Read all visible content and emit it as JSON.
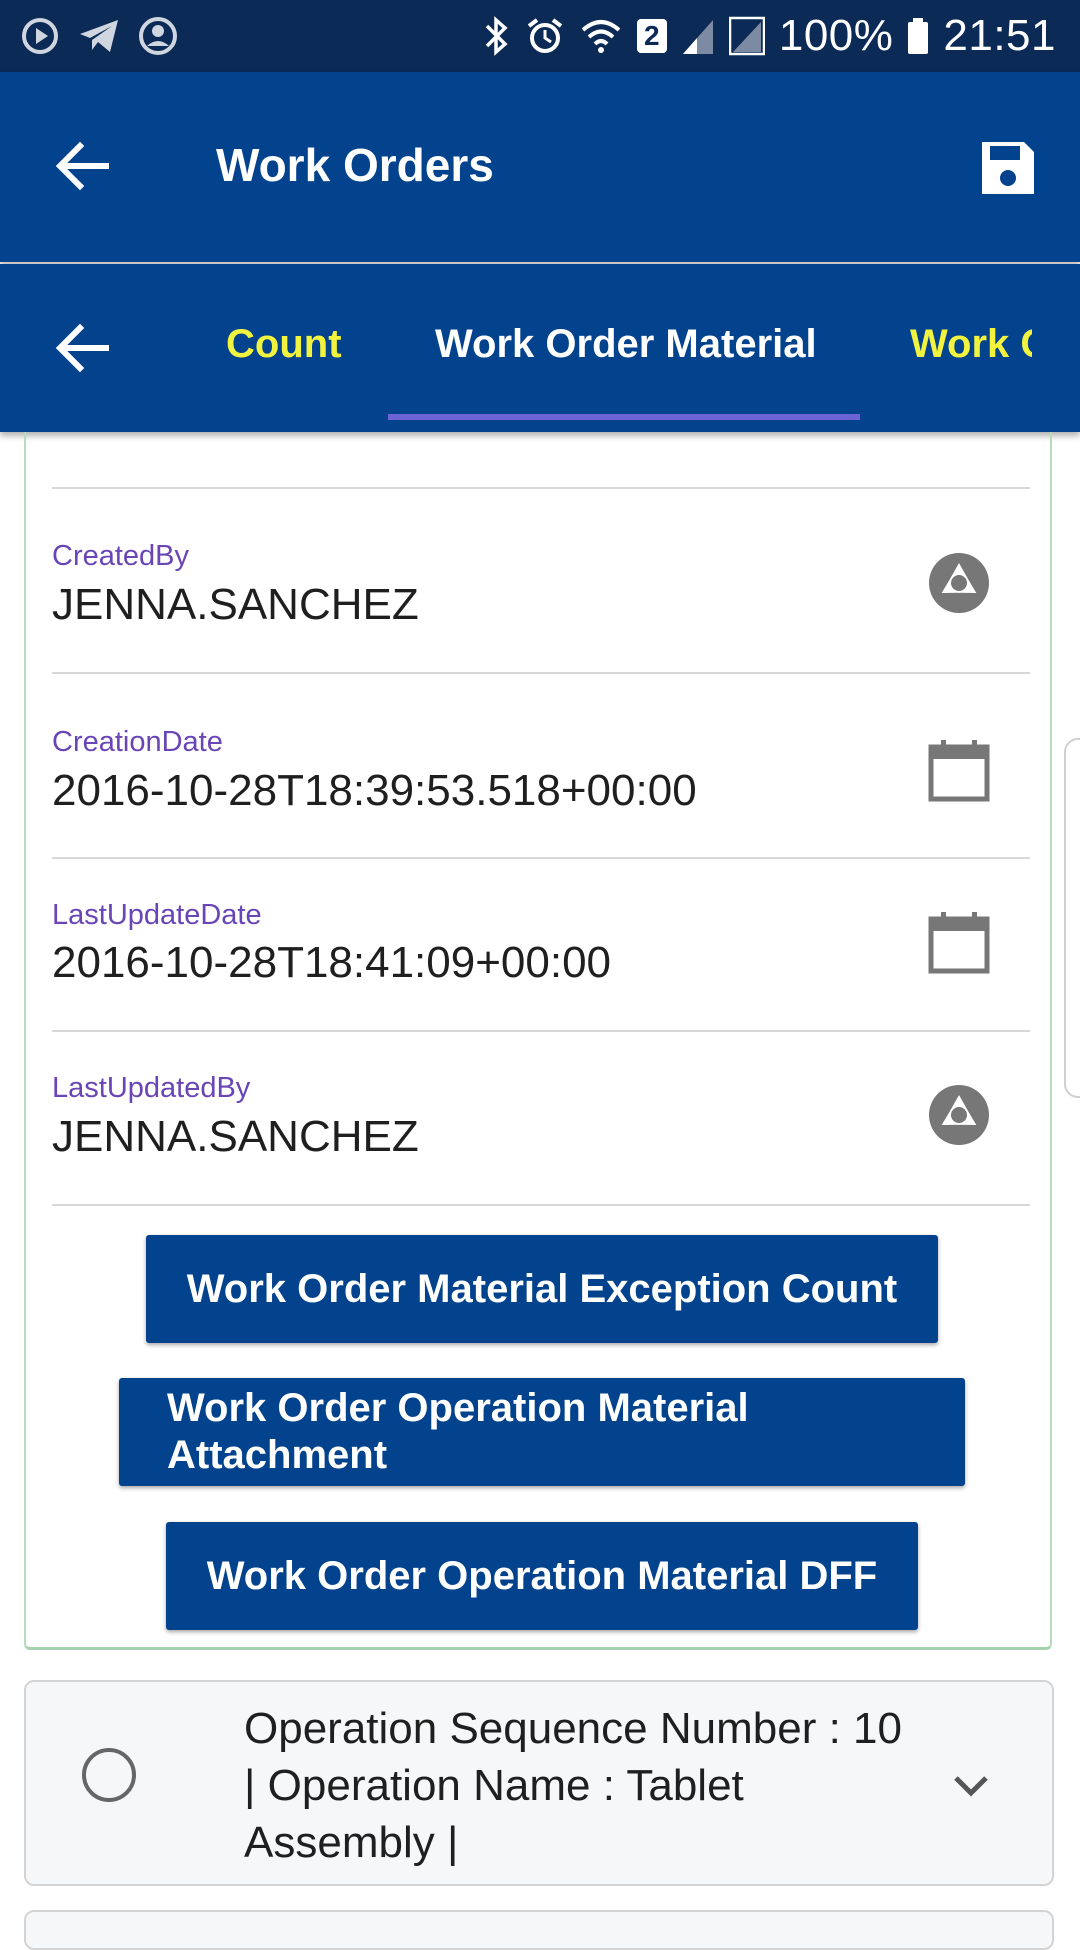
{
  "status_bar": {
    "battery": "100%",
    "time": "21:51",
    "sim_badge": "2",
    "icons": [
      "play-circle-icon",
      "telegram-icon",
      "account-circle-icon",
      "bluetooth-icon",
      "alarm-icon",
      "wifi-icon",
      "signal-icon",
      "signal-r-icon",
      "battery-icon"
    ]
  },
  "app_bar": {
    "title": "Work Orders",
    "back_icon": "back-arrow-icon",
    "save_icon": "save-icon"
  },
  "tabs": {
    "back_icon": "back-arrow-icon",
    "items": [
      {
        "label": "Count",
        "active": false
      },
      {
        "label": "Work Order Material",
        "active": true
      },
      {
        "label": "Work C",
        "active": false
      }
    ],
    "active_underline_color": "#6b63d6",
    "inactive_color": "#f2f33f"
  },
  "fields": [
    {
      "label": "CreatedBy",
      "value": "JENNA.SANCHEZ",
      "icon": "aperture-icon"
    },
    {
      "label": "CreationDate",
      "value": "2016-10-28T18:39:53.518+00:00",
      "icon": "calendar-icon"
    },
    {
      "label": "LastUpdateDate",
      "value": "2016-10-28T18:41:09+00:00",
      "icon": "calendar-icon"
    },
    {
      "label": "LastUpdatedBy",
      "value": "JENNA.SANCHEZ",
      "icon": "aperture-icon"
    }
  ],
  "buttons": {
    "exception_count": "Work Order Material Exception Count",
    "attachment_line1": "Work Order Operation Material",
    "attachment_line2": "Attachment",
    "dff": "Work Order Operation Material DFF"
  },
  "operation": {
    "text": "Operation Sequence Number : 10 | Operation Name : Tablet Assembly |",
    "expand_icon": "chevron-down-icon"
  },
  "colors": {
    "primary": "#03428c",
    "status_bar": "#0b2a55",
    "label": "#6a45b6",
    "card_border": "#b6dcbc"
  }
}
